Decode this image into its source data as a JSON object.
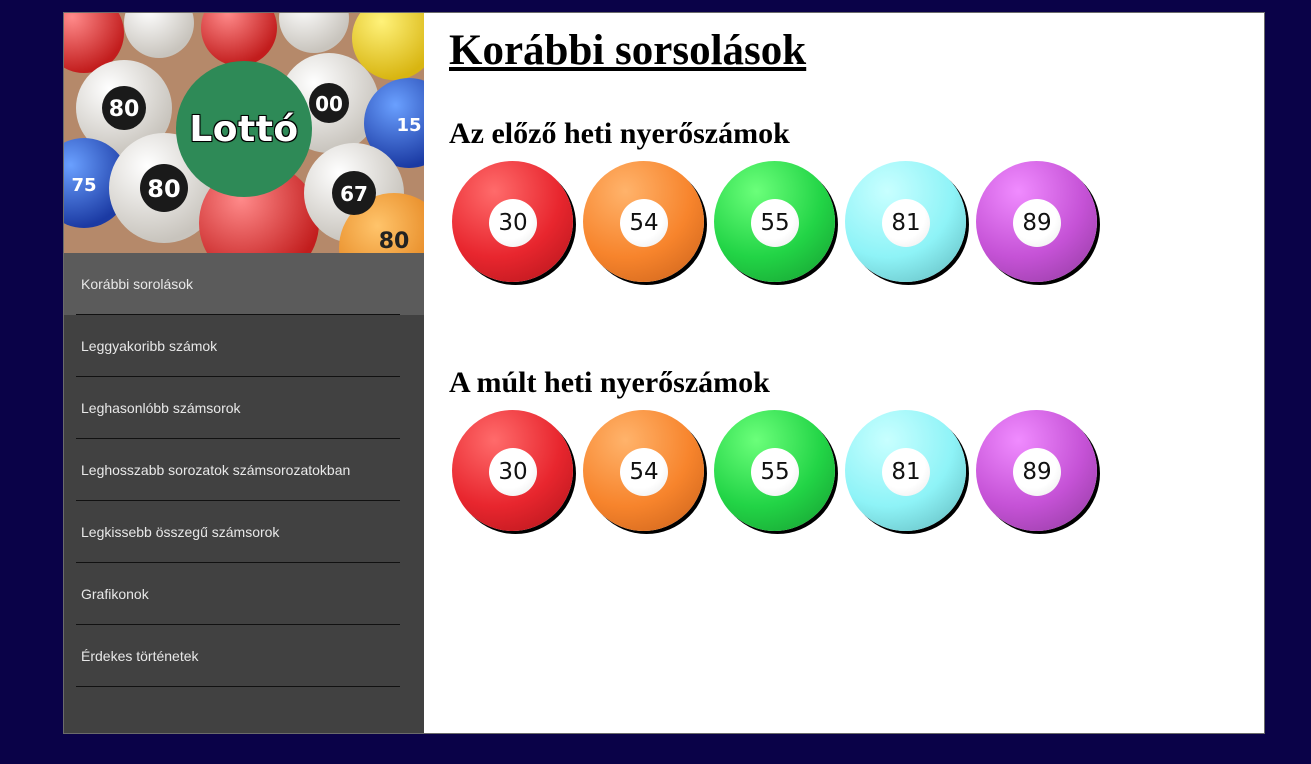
{
  "logo": {
    "text": "Lottó"
  },
  "nav": {
    "items": [
      {
        "label": "Korábbi sorolások",
        "active": true
      },
      {
        "label": "Leggyakoribb számok",
        "active": false
      },
      {
        "label": "Leghasonlóbb számsorok",
        "active": false
      },
      {
        "label": "Leghosszabb sorozatok számsorozatokban",
        "active": false
      },
      {
        "label": "Legkissebb összegű számsorok",
        "active": false
      },
      {
        "label": "Grafikonok",
        "active": false
      },
      {
        "label": "Érdekes történetek",
        "active": false
      }
    ]
  },
  "main": {
    "title": "Korábbi sorsolások",
    "sections": [
      {
        "title": "Az előző heti nyerőszámok",
        "numbers": [
          "30",
          "54",
          "55",
          "81",
          "89"
        ]
      },
      {
        "title": "A múlt heti nyerőszámok",
        "numbers": [
          "30",
          "54",
          "55",
          "81",
          "89"
        ]
      }
    ]
  },
  "colors": {
    "background": "#0a0248",
    "sidebar": "#414141",
    "sidebar_active": "#5b5b5b",
    "logo_circle": "#2e8a57",
    "ball_red": "#e8262e",
    "ball_orange": "#f7842c",
    "ball_green": "#22d446",
    "ball_cyan": "#8ef3f7",
    "ball_purple": "#c552d6"
  }
}
